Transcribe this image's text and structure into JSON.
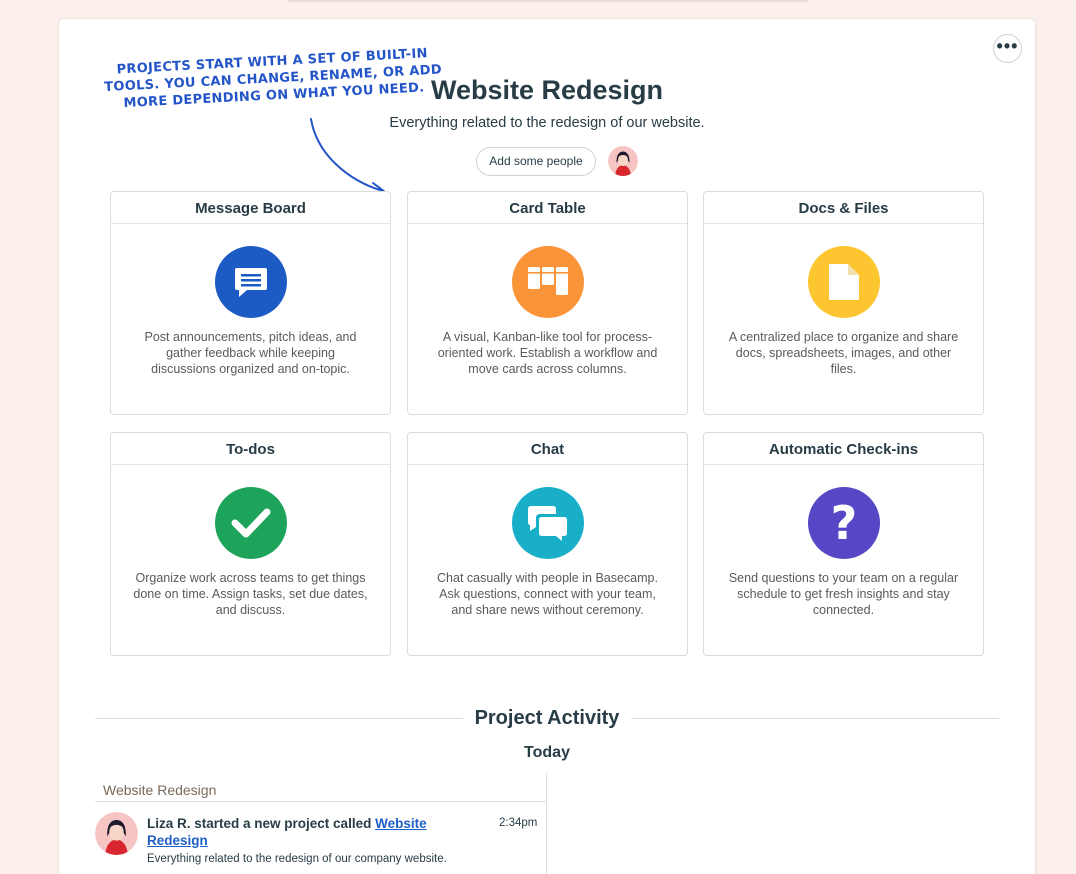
{
  "annotation": {
    "line1": "Projects start with a set of built-in",
    "line2": "tools. You can change, rename, or add",
    "line3": "more depending on what you need."
  },
  "project": {
    "title": "Website Redesign",
    "description": "Everything related to the redesign of our website.",
    "add_people_label": "Add some people",
    "options_icon": "ellipsis-icon"
  },
  "tools": [
    {
      "title": "Message Board",
      "description": "Post announcements, pitch ideas, and gather feedback while keeping discussions organized and on-topic.",
      "icon": "message-board-icon",
      "color": "#1d5bc4"
    },
    {
      "title": "Card Table",
      "description": "A visual, Kanban-like tool for process-oriented work. Establish a workflow and move cards across columns.",
      "icon": "card-table-icon",
      "color": "#f99438"
    },
    {
      "title": "Docs & Files",
      "description": "A centralized place to organize and share docs, spreadsheets, images, and other files.",
      "icon": "document-icon",
      "color": "#fdc530"
    },
    {
      "title": "To-dos",
      "description": "Organize work across teams to get things done on time. Assign tasks, set due dates, and discuss.",
      "icon": "checkmark-icon",
      "color": "#1ea45a"
    },
    {
      "title": "Chat",
      "description": "Chat casually with people in Basecamp. Ask questions, connect with your team, and share news without ceremony.",
      "icon": "chat-bubbles-icon",
      "color": "#1aafc9"
    },
    {
      "title": "Automatic Check-ins",
      "description": "Send questions to your team on a regular schedule to get fresh insights and stay connected.",
      "icon": "question-mark-icon",
      "color": "#5647c6"
    }
  ],
  "activity": {
    "title": "Project Activity",
    "day_label": "Today",
    "project_label": "Website Redesign",
    "entry": {
      "actor_text": "Liza R. started a new project called ",
      "link_text": "Website Redesign",
      "time": "2:34pm",
      "excerpt": "Everything related to the redesign of our company website."
    }
  }
}
